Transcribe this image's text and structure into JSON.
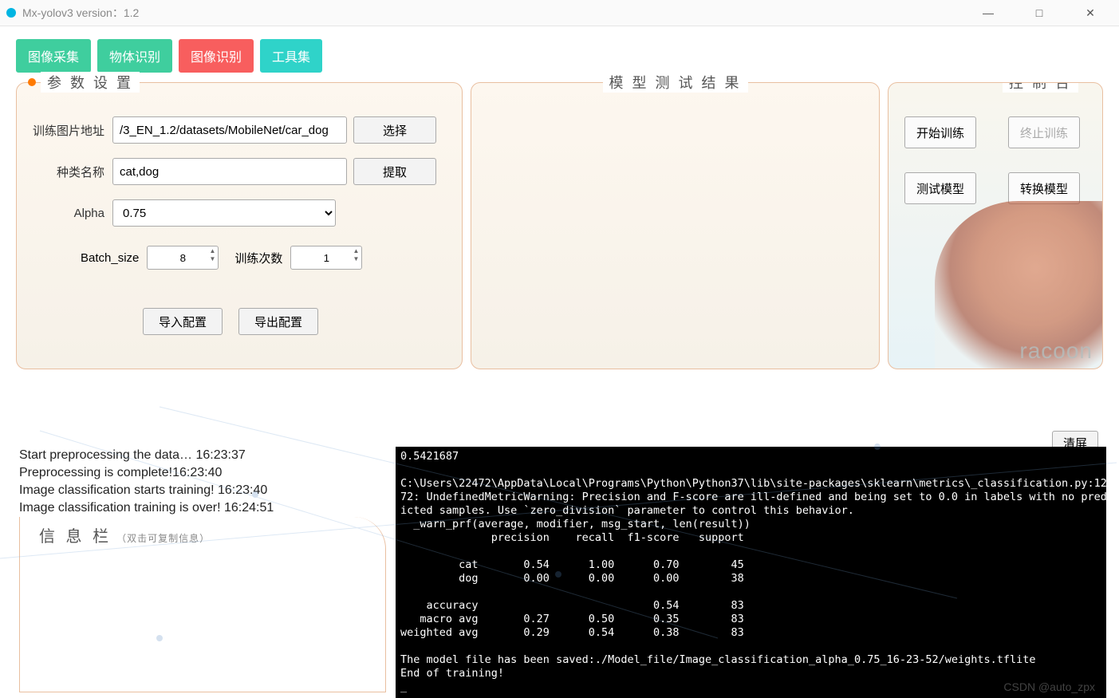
{
  "window": {
    "title": "Mx-yolov3 version：1.2",
    "minimize": "—",
    "maximize": "□",
    "close": "✕"
  },
  "tabs": [
    "图像采集",
    "物体识别",
    "图像识别",
    "工具集"
  ],
  "panel1": {
    "title": "参 数 设 置",
    "train_path_label": "训练图片地址",
    "train_path_value": "/3_EN_1.2/datasets/MobileNet/car_dog",
    "select_btn": "选择",
    "class_label": "种类名称",
    "class_value": "cat,dog",
    "extract_btn": "提取",
    "alpha_label": "Alpha",
    "alpha_value": "0.75",
    "batch_label": "Batch_size",
    "batch_value": "8",
    "epoch_label": "训练次数",
    "epoch_value": "1",
    "import_btn": "导入配置",
    "export_btn": "导出配置"
  },
  "panel2": {
    "title": "模 型 测 试 结 果"
  },
  "panel3": {
    "title": "控 制 台",
    "start_train": "开始训练",
    "stop_train": "终止训练",
    "test_model": "测试模型",
    "convert_model": "转换模型",
    "racoon": "racoon"
  },
  "clear_btn": "清屏",
  "loglines": [
    "Start preprocessing the data…  16:23:37",
    "Preprocessing is complete!16:23:40",
    "Image classification starts training!  16:23:40",
    "Image classification training is over!  16:24:51"
  ],
  "infobar": {
    "t1": "信 息 栏",
    "t2": "（双击可复制信息）"
  },
  "console_text": "0.5421687\n\nC:\\Users\\22472\\AppData\\Local\\Programs\\Python\\Python37\\lib\\site-packages\\sklearn\\metrics\\_classification.py:12\n72: UndefinedMetricWarning: Precision and F-score are ill-defined and being set to 0.0 in labels with no pred\nicted samples. Use `zero_division` parameter to control this behavior.\n  _warn_prf(average, modifier, msg_start, len(result))\n              precision    recall  f1-score   support\n\n         cat       0.54      1.00      0.70        45\n         dog       0.00      0.00      0.00        38\n\n    accuracy                           0.54        83\n   macro avg       0.27      0.50      0.35        83\nweighted avg       0.29      0.54      0.38        83\n\nThe model file has been saved:./Model_file/Image_classification_alpha_0.75_16-23-52/weights.tflite\nEnd of training!\n_",
  "watermark": "CSDN @auto_zpx"
}
